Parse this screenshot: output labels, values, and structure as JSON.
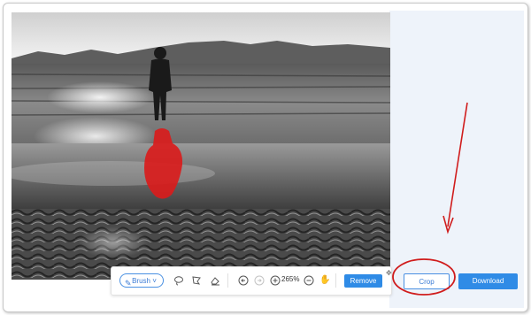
{
  "toolbar": {
    "brush_label": "Brush",
    "zoom_level": "265%",
    "remove_label": "Remove"
  },
  "actions": {
    "crop_label": "Crop",
    "download_label": "Download"
  },
  "icons": {
    "brush": "pen-icon",
    "lasso": "lasso-icon",
    "polygon_lasso": "polygon-lasso-icon",
    "eraser": "eraser-icon",
    "undo": "undo-icon",
    "redo": "redo-icon",
    "zoom_in": "zoom-in-icon",
    "zoom_out": "zoom-out-icon",
    "pan": "hand-icon",
    "move": "move-icon"
  },
  "colors": {
    "accent": "#2f8be6",
    "mask": "#d91c1c",
    "annotation": "#d01c1c",
    "panel": "#eef3fa"
  }
}
